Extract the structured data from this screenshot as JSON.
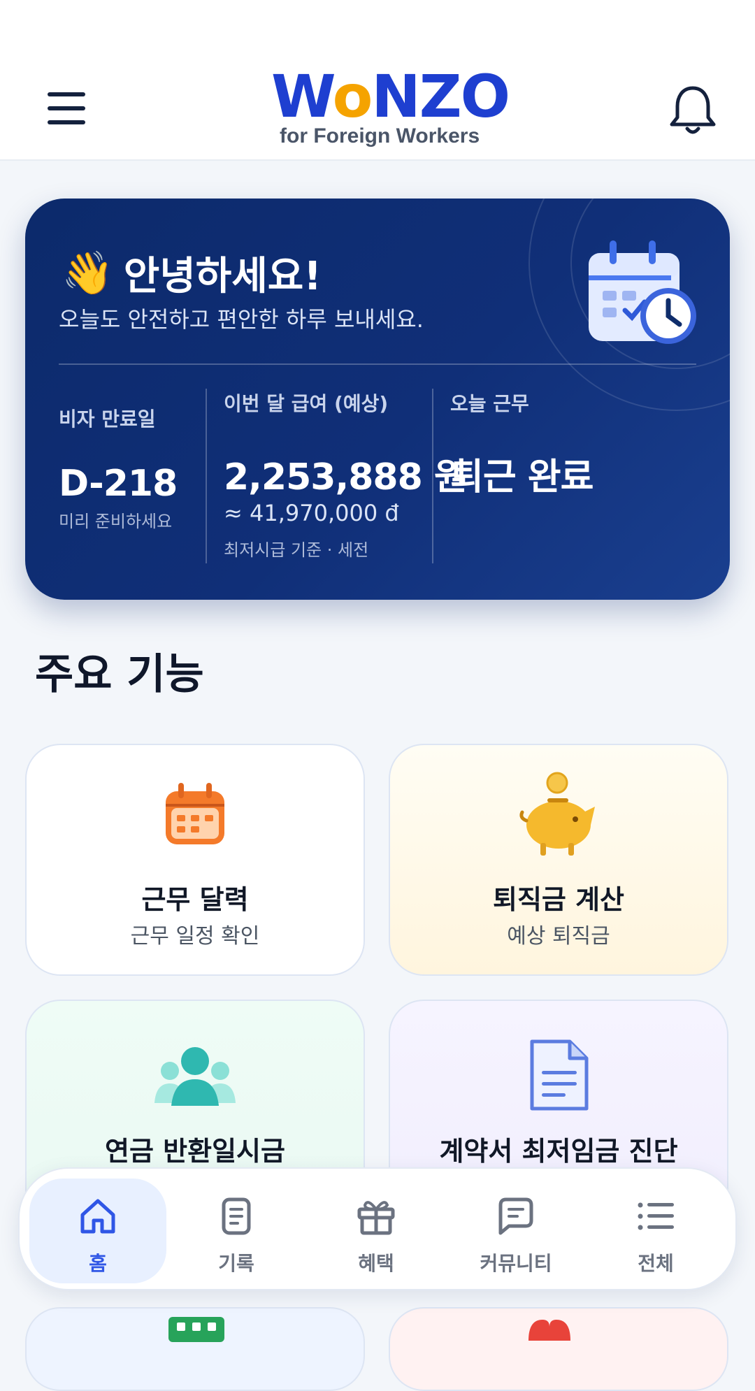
{
  "header": {
    "logo_text": "WONZO",
    "logo_sub": "for Foreign Workers",
    "menu_icon": "menu-icon",
    "bell_icon": "bell-icon"
  },
  "hero": {
    "greeting_emoji": "👋",
    "greeting_title": "안녕하세요!",
    "greeting_sub": "오늘도 안전하고 편안한 하루 보내세요.",
    "visa": {
      "label": "비자 만료일",
      "value": "D-218",
      "note": "미리 준비하세요"
    },
    "salary": {
      "label": "이번 달 급여 (예상)",
      "value": "2,253,888 원",
      "converted": "≈ 41,970,000 đ",
      "note": "최저시급 기준 · 세전"
    },
    "work": {
      "label": "오늘 근무",
      "value": "퇴근 완료"
    }
  },
  "section": {
    "title": "주요 기능"
  },
  "features": [
    {
      "title": "근무 달력",
      "subtitle": "근무 일정 확인",
      "icon": "calendar-icon"
    },
    {
      "title": "퇴직금 계산",
      "subtitle": "예상 퇴직금",
      "icon": "piggy-bank-icon"
    },
    {
      "title": "연금 반환일시금",
      "subtitle": "",
      "icon": "people-icon"
    },
    {
      "title": "계약서 최저임금 진단",
      "subtitle": "",
      "icon": "document-icon"
    }
  ],
  "nav": {
    "items": [
      {
        "label": "홈",
        "icon": "home-icon",
        "active": true
      },
      {
        "label": "기록",
        "icon": "record-icon",
        "active": false
      },
      {
        "label": "혜택",
        "icon": "gift-icon",
        "active": false
      },
      {
        "label": "커뮤니티",
        "icon": "chat-icon",
        "active": false
      },
      {
        "label": "전체",
        "icon": "list-icon",
        "active": false
      }
    ]
  },
  "colors": {
    "brand": "#1e3fd0",
    "hero_bg": "#102f78",
    "nav_active": "#2f56e6"
  }
}
